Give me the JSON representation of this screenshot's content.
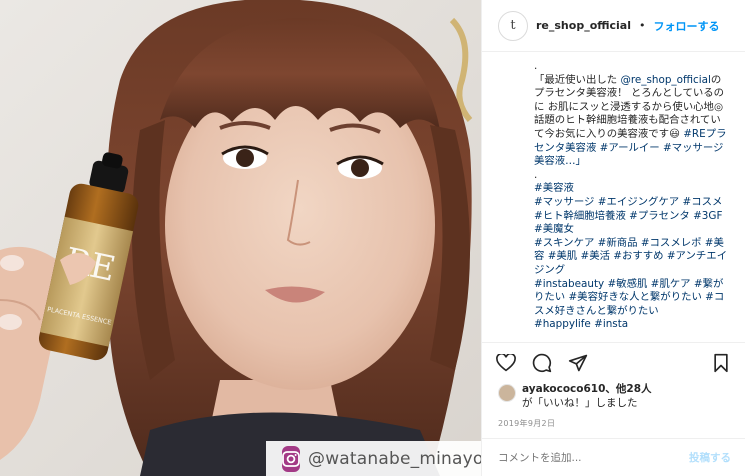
{
  "header": {
    "avatar_letter": "t",
    "username": "re_shop_official",
    "separator": "•",
    "follow_label": "フォローする"
  },
  "caption": {
    "lead": ".",
    "quote_start": "「最近使い出した ",
    "mention": "@re_shop_official",
    "quote_body": "のプラセンタ美容液！ とろんとしているのに お肌にスッと浸透するから使い心地◎ 話題のヒト幹細胞培養液も配合されていて今お気に入りの美容液です😃 ",
    "quote_tags": "#REプラセンタ美容液 #アールイー #マッサージ美容液…」",
    "dot": ".",
    "hashtags": "#美容液\n#マッサージ #エイジングケア #コスメ #ヒト幹細胞培養液 #プラセンタ #3GF #美魔女\n#スキンケア #新商品 #コスメレポ #美容 #美肌 #美活 #おすすめ #アンチエイジング\n#instabeauty #敏感肌 #肌ケア #繋がりたい #美容好きな人と繋がりたい #コスメ好きさんと繋がりたい\n#happylife #insta"
  },
  "actions": {
    "like_icon": "heart-icon",
    "comment_icon": "comment-icon",
    "share_icon": "paper-plane-icon",
    "save_icon": "bookmark-icon"
  },
  "likes": {
    "user": "ayakococo610",
    "others": "、他28人",
    "line2": "が「いいね！」しました"
  },
  "date": "2019年9月2日",
  "comment": {
    "placeholder": "コメントを追加...",
    "post_label": "投稿する"
  },
  "photo": {
    "watermark_handle": "@watanabe_minayo",
    "bottle_logo": "RE",
    "bottle_label": "PLACENTA ESSENCE"
  },
  "colors": {
    "link_blue": "#0095f6",
    "hashtag_navy": "#00376b",
    "muted_gray": "#8e8e8e",
    "watermark_purple": "#a33a86"
  }
}
